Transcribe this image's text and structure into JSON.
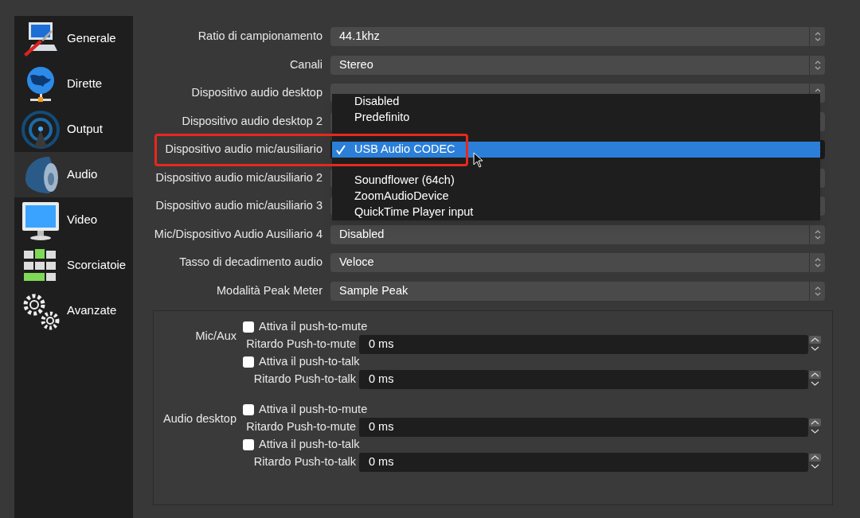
{
  "sidebar": {
    "items": [
      {
        "label": "Generale",
        "selected": false
      },
      {
        "label": "Dirette",
        "selected": false
      },
      {
        "label": "Output",
        "selected": false
      },
      {
        "label": "Audio",
        "selected": true
      },
      {
        "label": "Video",
        "selected": false
      },
      {
        "label": "Scorciatoie",
        "selected": false
      },
      {
        "label": "Avanzate",
        "selected": false
      }
    ]
  },
  "settings": [
    {
      "label": "Ratio di campionamento",
      "value": "44.1khz",
      "focused": false
    },
    {
      "label": "Canali",
      "value": "Stereo",
      "focused": false
    },
    {
      "label": "Dispositivo audio desktop",
      "focused": false
    },
    {
      "label": "Dispositivo audio desktop 2",
      "focused": false
    },
    {
      "label": "Dispositivo audio mic/ausiliario",
      "focused": true,
      "highlighted": true
    },
    {
      "label": "Dispositivo audio mic/ausiliario 2",
      "focused": false
    },
    {
      "label": "Dispositivo audio mic/ausiliario 3",
      "focused": false
    },
    {
      "label": "Mic/Dispositivo Audio Ausiliario 4",
      "value": "Disabled",
      "focused": false
    },
    {
      "label": "Tasso di decadimento audio",
      "value": "Veloce",
      "focused": false
    },
    {
      "label": "Modalità Peak Meter",
      "value": "Sample Peak",
      "focused": false
    }
  ],
  "dropdown": {
    "items": [
      {
        "label": "Disabled",
        "selected": false
      },
      {
        "label": "Predefinito",
        "selected": false
      },
      {
        "selected": false
      },
      {
        "label": "USB Audio CODEC",
        "selected": true
      },
      {
        "selected": false
      },
      {
        "label": "Soundflower (64ch)",
        "selected": false
      },
      {
        "label": "ZoomAudioDevice",
        "selected": false
      },
      {
        "label": "QuickTime Player input",
        "selected": false
      }
    ]
  },
  "hotkeys": [
    {
      "label": "Mic/Aux",
      "rows": [
        {
          "kind": "checkbox",
          "label": "Attiva il push-to-mute",
          "checked": false
        },
        {
          "kind": "spin",
          "label": "Ritardo Push-to-mute",
          "value": "0 ms"
        },
        {
          "kind": "checkbox",
          "label": "Attiva il push-to-talk",
          "checked": false
        },
        {
          "kind": "spin",
          "label": "Ritardo Push-to-talk",
          "value": "0 ms"
        }
      ]
    },
    {
      "label": "Audio desktop",
      "rows": [
        {
          "kind": "checkbox",
          "label": "Attiva il push-to-mute",
          "checked": false
        },
        {
          "kind": "spin",
          "label": "Ritardo Push-to-mute",
          "value": "0 ms"
        },
        {
          "kind": "checkbox",
          "label": "Attiva il push-to-talk",
          "checked": false
        },
        {
          "kind": "spin",
          "label": "Ritardo Push-to-talk",
          "value": "0 ms"
        }
      ]
    }
  ]
}
